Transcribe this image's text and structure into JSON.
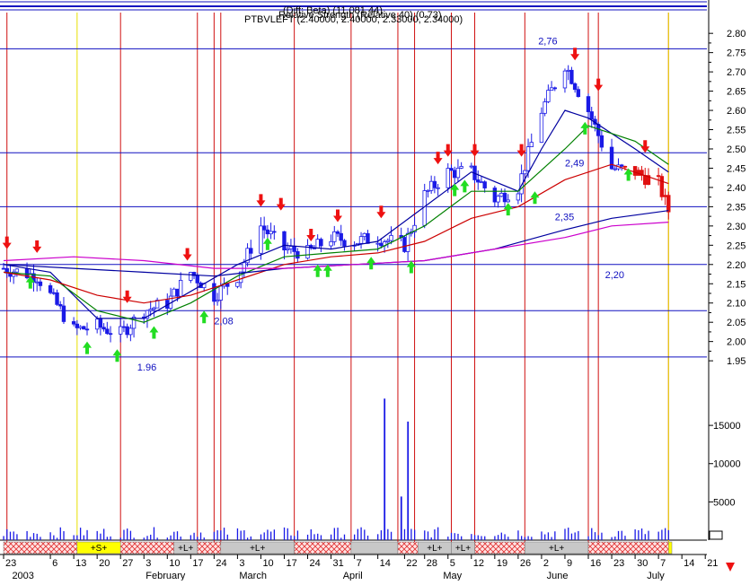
{
  "chart_title": {
    "line1": "(Diff: Beta) (11 081 44)",
    "line2": "Relative Strength (Relative 40) (0.73)",
    "line3": "PTBVLEFT (2.40000, 2.40000, 2.33000, 2.34000)"
  },
  "colors": {
    "background": "#ffffff",
    "up_candle": "#ffffff",
    "down_candle": "#1a1ae6",
    "red_candle": "#e01010",
    "level_line": "#1010c0",
    "event_line": "#d01010",
    "yellow_line": "#e8e000",
    "ma_blue": "#0000a0",
    "ma_green": "#008000",
    "ma_red": "#cc0000",
    "ma_magenta": "#cc00cc",
    "arrow_down": "#ee1111",
    "arrow_up": "#22dd22",
    "volume": "#1a1ae6"
  },
  "chart_data": {
    "type": "candlestick",
    "symbol": "PTBVLEFT",
    "price_axis": {
      "ticks": [
        "2.80",
        "2.75",
        "2.70",
        "2.65",
        "2.60",
        "2.55",
        "2.50",
        "2.45",
        "2.40",
        "2.35",
        "2.30",
        "2.25",
        "2.20",
        "2.15",
        "2.10",
        "2.05",
        "2.00",
        "1.95"
      ],
      "range": [
        1.92,
        2.84
      ]
    },
    "volume_axis": {
      "ticks": [
        "15000",
        "10000",
        "5000"
      ],
      "range": [
        0,
        19000
      ]
    },
    "x_labels": [
      {
        "label": "23",
        "d": 0
      },
      {
        "label": "6",
        "d": 14
      },
      {
        "label": "13",
        "d": 21
      },
      {
        "label": "20",
        "d": 28
      },
      {
        "label": "27",
        "d": 35
      },
      {
        "label": "3",
        "d": 42
      },
      {
        "label": "10",
        "d": 49
      },
      {
        "label": "17",
        "d": 56
      },
      {
        "label": "24",
        "d": 63
      },
      {
        "label": "3",
        "d": 70
      },
      {
        "label": "10",
        "d": 77
      },
      {
        "label": "17",
        "d": 84
      },
      {
        "label": "24",
        "d": 91
      },
      {
        "label": "31",
        "d": 98
      },
      {
        "label": "7",
        "d": 105
      },
      {
        "label": "14",
        "d": 112
      },
      {
        "label": "22",
        "d": 120
      },
      {
        "label": "28",
        "d": 126
      },
      {
        "label": "5",
        "d": 133
      },
      {
        "label": "12",
        "d": 140
      },
      {
        "label": "19",
        "d": 147
      },
      {
        "label": "26",
        "d": 154
      },
      {
        "label": "2",
        "d": 161
      },
      {
        "label": "9",
        "d": 168
      },
      {
        "label": "16",
        "d": 175
      },
      {
        "label": "23",
        "d": 182
      },
      {
        "label": "30",
        "d": 189
      },
      {
        "label": "7",
        "d": 196
      },
      {
        "label": "14",
        "d": 203
      },
      {
        "label": "21",
        "d": 210
      }
    ],
    "month_labels": [
      {
        "label": "2003",
        "d": 2
      },
      {
        "label": "February",
        "d": 42
      },
      {
        "label": "March",
        "d": 70
      },
      {
        "label": "April",
        "d": 101
      },
      {
        "label": "May",
        "d": 131
      },
      {
        "label": "June",
        "d": 162
      },
      {
        "label": "July",
        "d": 192
      }
    ],
    "levels": [
      {
        "value": 2.76,
        "label": "2,76",
        "label_d": 160,
        "label_side": "above"
      },
      {
        "value": 2.49,
        "label": "2,49",
        "label_d": 168,
        "label_side": "below"
      },
      {
        "value": 2.35,
        "label": "2,35",
        "label_d": 165,
        "label_side": "below"
      },
      {
        "value": 2.2,
        "label": "2,20",
        "label_d": 180,
        "label_side": "below"
      },
      {
        "value": 2.08,
        "label": "2,08",
        "label_d": 63,
        "label_side": "below"
      },
      {
        "value": 1.96,
        "label": "1.96",
        "label_d": 40,
        "label_side": "below"
      }
    ],
    "event_lines_d": [
      1,
      35,
      58,
      63,
      65,
      87,
      104,
      118,
      123,
      134,
      141,
      156,
      175,
      178,
      199
    ],
    "yellow_lines_d": [
      22,
      199
    ],
    "bands": [
      {
        "label": "",
        "d0": 0,
        "d1": 22,
        "type": "hatch"
      },
      {
        "label": "+S+",
        "d0": 22,
        "d1": 35,
        "type": "yellow"
      },
      {
        "label": "",
        "d0": 35,
        "d1": 51,
        "type": "hatch"
      },
      {
        "label": "+L+",
        "d0": 51,
        "d1": 58,
        "type": "gray"
      },
      {
        "label": "",
        "d0": 58,
        "d1": 65,
        "type": "hatch"
      },
      {
        "label": "+L+",
        "d0": 65,
        "d1": 87,
        "type": "gray"
      },
      {
        "label": "",
        "d0": 87,
        "d1": 104,
        "type": "hatch"
      },
      {
        "label": "",
        "d0": 104,
        "d1": 118,
        "type": "gray"
      },
      {
        "label": "",
        "d0": 118,
        "d1": 124,
        "type": "hatch"
      },
      {
        "label": "+L+",
        "d0": 124,
        "d1": 134,
        "type": "gray"
      },
      {
        "label": "+L+",
        "d0": 134,
        "d1": 141,
        "type": "gray"
      },
      {
        "label": "",
        "d0": 141,
        "d1": 156,
        "type": "hatch"
      },
      {
        "label": "+L+",
        "d0": 156,
        "d1": 175,
        "type": "gray"
      },
      {
        "label": "",
        "d0": 175,
        "d1": 199,
        "type": "hatch"
      },
      {
        "label": "",
        "d0": 199,
        "d1": 200,
        "type": "yellow"
      }
    ],
    "anchors": [
      [
        0,
        2.19
      ],
      [
        10,
        2.17
      ],
      [
        14,
        2.12
      ],
      [
        21,
        2.03
      ],
      [
        28,
        2.04
      ],
      [
        35,
        2.02
      ],
      [
        42,
        2.08
      ],
      [
        49,
        2.1
      ],
      [
        56,
        2.18
      ],
      [
        63,
        2.12
      ],
      [
        70,
        2.17
      ],
      [
        77,
        2.3
      ],
      [
        84,
        2.24
      ],
      [
        91,
        2.23
      ],
      [
        98,
        2.27
      ],
      [
        105,
        2.26
      ],
      [
        112,
        2.27
      ],
      [
        120,
        2.25
      ],
      [
        126,
        2.38
      ],
      [
        133,
        2.44
      ],
      [
        140,
        2.44
      ],
      [
        147,
        2.37
      ],
      [
        154,
        2.4
      ],
      [
        161,
        2.6
      ],
      [
        168,
        2.72
      ],
      [
        175,
        2.6
      ],
      [
        182,
        2.45
      ],
      [
        189,
        2.44
      ],
      [
        196,
        2.41
      ],
      [
        199,
        2.34
      ]
    ],
    "ma_lines": [
      {
        "name": "",
        "color_key": "ma_blue",
        "points": [
          [
            0,
            2.2
          ],
          [
            14,
            2.18
          ],
          [
            28,
            2.06
          ],
          [
            42,
            2.06
          ],
          [
            56,
            2.13
          ],
          [
            70,
            2.2
          ],
          [
            84,
            2.25
          ],
          [
            98,
            2.24
          ],
          [
            112,
            2.26
          ],
          [
            126,
            2.35
          ],
          [
            140,
            2.44
          ],
          [
            154,
            2.39
          ],
          [
            161,
            2.5
          ],
          [
            168,
            2.6
          ],
          [
            175,
            2.58
          ],
          [
            189,
            2.5
          ],
          [
            199,
            2.44
          ]
        ]
      },
      {
        "name": "",
        "color_key": "ma_green",
        "points": [
          [
            0,
            2.18
          ],
          [
            14,
            2.17
          ],
          [
            28,
            2.08
          ],
          [
            42,
            2.05
          ],
          [
            56,
            2.1
          ],
          [
            70,
            2.17
          ],
          [
            84,
            2.22
          ],
          [
            98,
            2.23
          ],
          [
            112,
            2.24
          ],
          [
            126,
            2.3
          ],
          [
            140,
            2.39
          ],
          [
            154,
            2.39
          ],
          [
            168,
            2.5
          ],
          [
            175,
            2.56
          ],
          [
            189,
            2.52
          ],
          [
            199,
            2.46
          ]
        ]
      },
      {
        "name": "",
        "color_key": "ma_red",
        "points": [
          [
            0,
            2.18
          ],
          [
            14,
            2.16
          ],
          [
            28,
            2.12
          ],
          [
            42,
            2.1
          ],
          [
            56,
            2.12
          ],
          [
            70,
            2.16
          ],
          [
            84,
            2.2
          ],
          [
            98,
            2.22
          ],
          [
            112,
            2.23
          ],
          [
            126,
            2.26
          ],
          [
            140,
            2.32
          ],
          [
            154,
            2.35
          ],
          [
            168,
            2.42
          ],
          [
            182,
            2.46
          ],
          [
            199,
            2.41
          ]
        ]
      },
      {
        "name": "",
        "color_key": "ma_blue",
        "points": [
          [
            0,
            2.2
          ],
          [
            21,
            2.19
          ],
          [
            42,
            2.18
          ],
          [
            63,
            2.17
          ],
          [
            84,
            2.19
          ],
          [
            105,
            2.2
          ],
          [
            126,
            2.21
          ],
          [
            147,
            2.24
          ],
          [
            168,
            2.29
          ],
          [
            182,
            2.32
          ],
          [
            199,
            2.34
          ]
        ]
      },
      {
        "name": "",
        "color_key": "ma_magenta",
        "points": [
          [
            0,
            2.21
          ],
          [
            21,
            2.22
          ],
          [
            42,
            2.21
          ],
          [
            63,
            2.19
          ],
          [
            84,
            2.19
          ],
          [
            105,
            2.2
          ],
          [
            126,
            2.21
          ],
          [
            147,
            2.24
          ],
          [
            168,
            2.27
          ],
          [
            182,
            2.3
          ],
          [
            199,
            2.31
          ]
        ]
      }
    ],
    "arrows_down": [
      {
        "d": 1,
        "v": 2.24
      },
      {
        "d": 10,
        "v": 2.23
      },
      {
        "d": 37,
        "v": 2.1
      },
      {
        "d": 55,
        "v": 2.21
      },
      {
        "d": 77,
        "v": 2.35
      },
      {
        "d": 83,
        "v": 2.34
      },
      {
        "d": 92,
        "v": 2.26
      },
      {
        "d": 100,
        "v": 2.31
      },
      {
        "d": 113,
        "v": 2.32
      },
      {
        "d": 130,
        "v": 2.46
      },
      {
        "d": 133,
        "v": 2.48
      },
      {
        "d": 141,
        "v": 2.48
      },
      {
        "d": 155,
        "v": 2.48
      },
      {
        "d": 171,
        "v": 2.73
      },
      {
        "d": 178,
        "v": 2.65
      },
      {
        "d": 192,
        "v": 2.49
      }
    ],
    "arrows_up": [
      {
        "d": 8,
        "v": 2.17
      },
      {
        "d": 25,
        "v": 2.0
      },
      {
        "d": 34,
        "v": 1.98
      },
      {
        "d": 45,
        "v": 2.04
      },
      {
        "d": 60,
        "v": 2.08
      },
      {
        "d": 79,
        "v": 2.27
      },
      {
        "d": 94,
        "v": 2.2
      },
      {
        "d": 97,
        "v": 2.2
      },
      {
        "d": 110,
        "v": 2.22
      },
      {
        "d": 122,
        "v": 2.21
      },
      {
        "d": 135,
        "v": 2.41
      },
      {
        "d": 138,
        "v": 2.42
      },
      {
        "d": 151,
        "v": 2.36
      },
      {
        "d": 159,
        "v": 2.39
      },
      {
        "d": 174,
        "v": 2.57
      },
      {
        "d": 187,
        "v": 2.45
      }
    ],
    "volume_spikes": [
      {
        "d": 114,
        "v": 18500
      },
      {
        "d": 119,
        "v": 5700
      },
      {
        "d": 121,
        "v": 15500
      }
    ]
  }
}
